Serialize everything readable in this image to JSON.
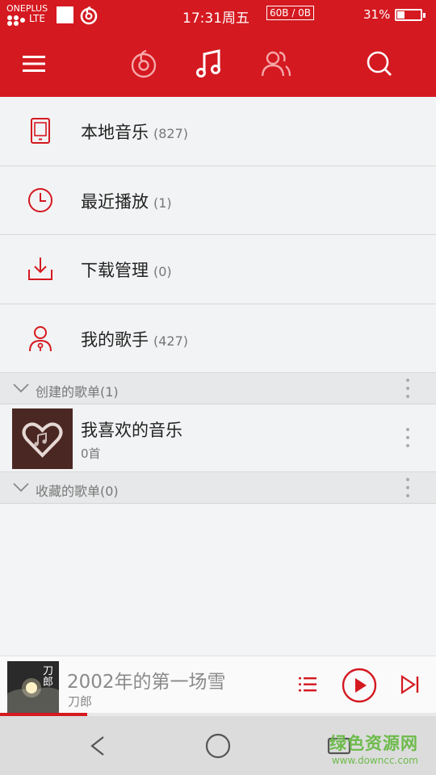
{
  "status_bar": {
    "carrier": "ONEPLUS",
    "network_type": "LTE",
    "time": "17:31周五",
    "net_speed": "60B / 0B",
    "battery_percent": "31%",
    "battery_level": 0.31
  },
  "top_nav": {
    "icons": [
      "menu-icon",
      "netease-music-icon",
      "music-note-icon",
      "friends-icon",
      "search-icon"
    ],
    "active": "music-note-icon"
  },
  "menu": [
    {
      "icon": "phone-icon",
      "label": "本地音乐",
      "count": "(827)"
    },
    {
      "icon": "clock-icon",
      "label": "最近播放",
      "count": "(1)"
    },
    {
      "icon": "download-icon",
      "label": "下载管理",
      "count": "(0)"
    },
    {
      "icon": "singer-icon",
      "label": "我的歌手",
      "count": "(427)"
    }
  ],
  "created_section": {
    "title": "创建的歌单(1)"
  },
  "playlists": [
    {
      "name": "我喜欢的音乐",
      "count": "0首"
    }
  ],
  "collected_section": {
    "title": "收藏的歌单(0)"
  },
  "player": {
    "song": "2002年的第一场雪",
    "artist": "刀郎",
    "cover_text": "刀郎",
    "progress": 0.2
  },
  "watermark": {
    "line1": "绿色资源网",
    "line2": "www.downcc.com"
  },
  "colors": {
    "brand": "#d41920",
    "background": "#f2f3f4"
  }
}
